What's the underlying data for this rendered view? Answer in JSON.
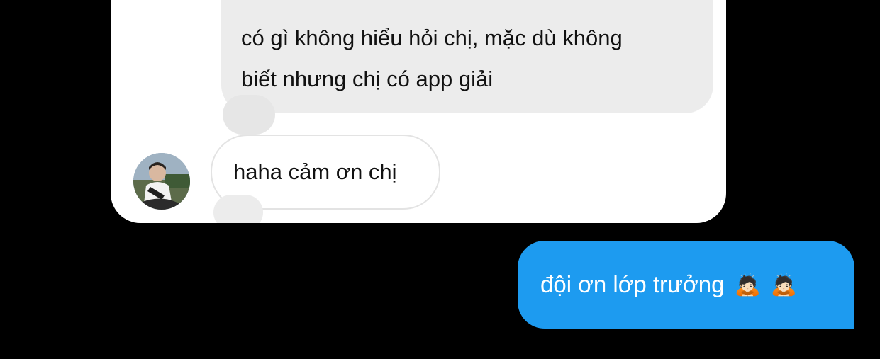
{
  "shared_image": {
    "gray_message": "có gì không hiểu hỏi chị, mặc dù không\nbiết nhưng chị có app giải",
    "white_message": "haha cảm ơn chị"
  },
  "reply": {
    "text": "đội ơn lớp trưởng",
    "emojis": [
      "🙇🏻",
      "🙇🏻"
    ]
  },
  "colors": {
    "background": "#000000",
    "reply_bubble": "#1d9bf0",
    "card_background": "#ffffff",
    "gray_bubble": "#ececec"
  }
}
